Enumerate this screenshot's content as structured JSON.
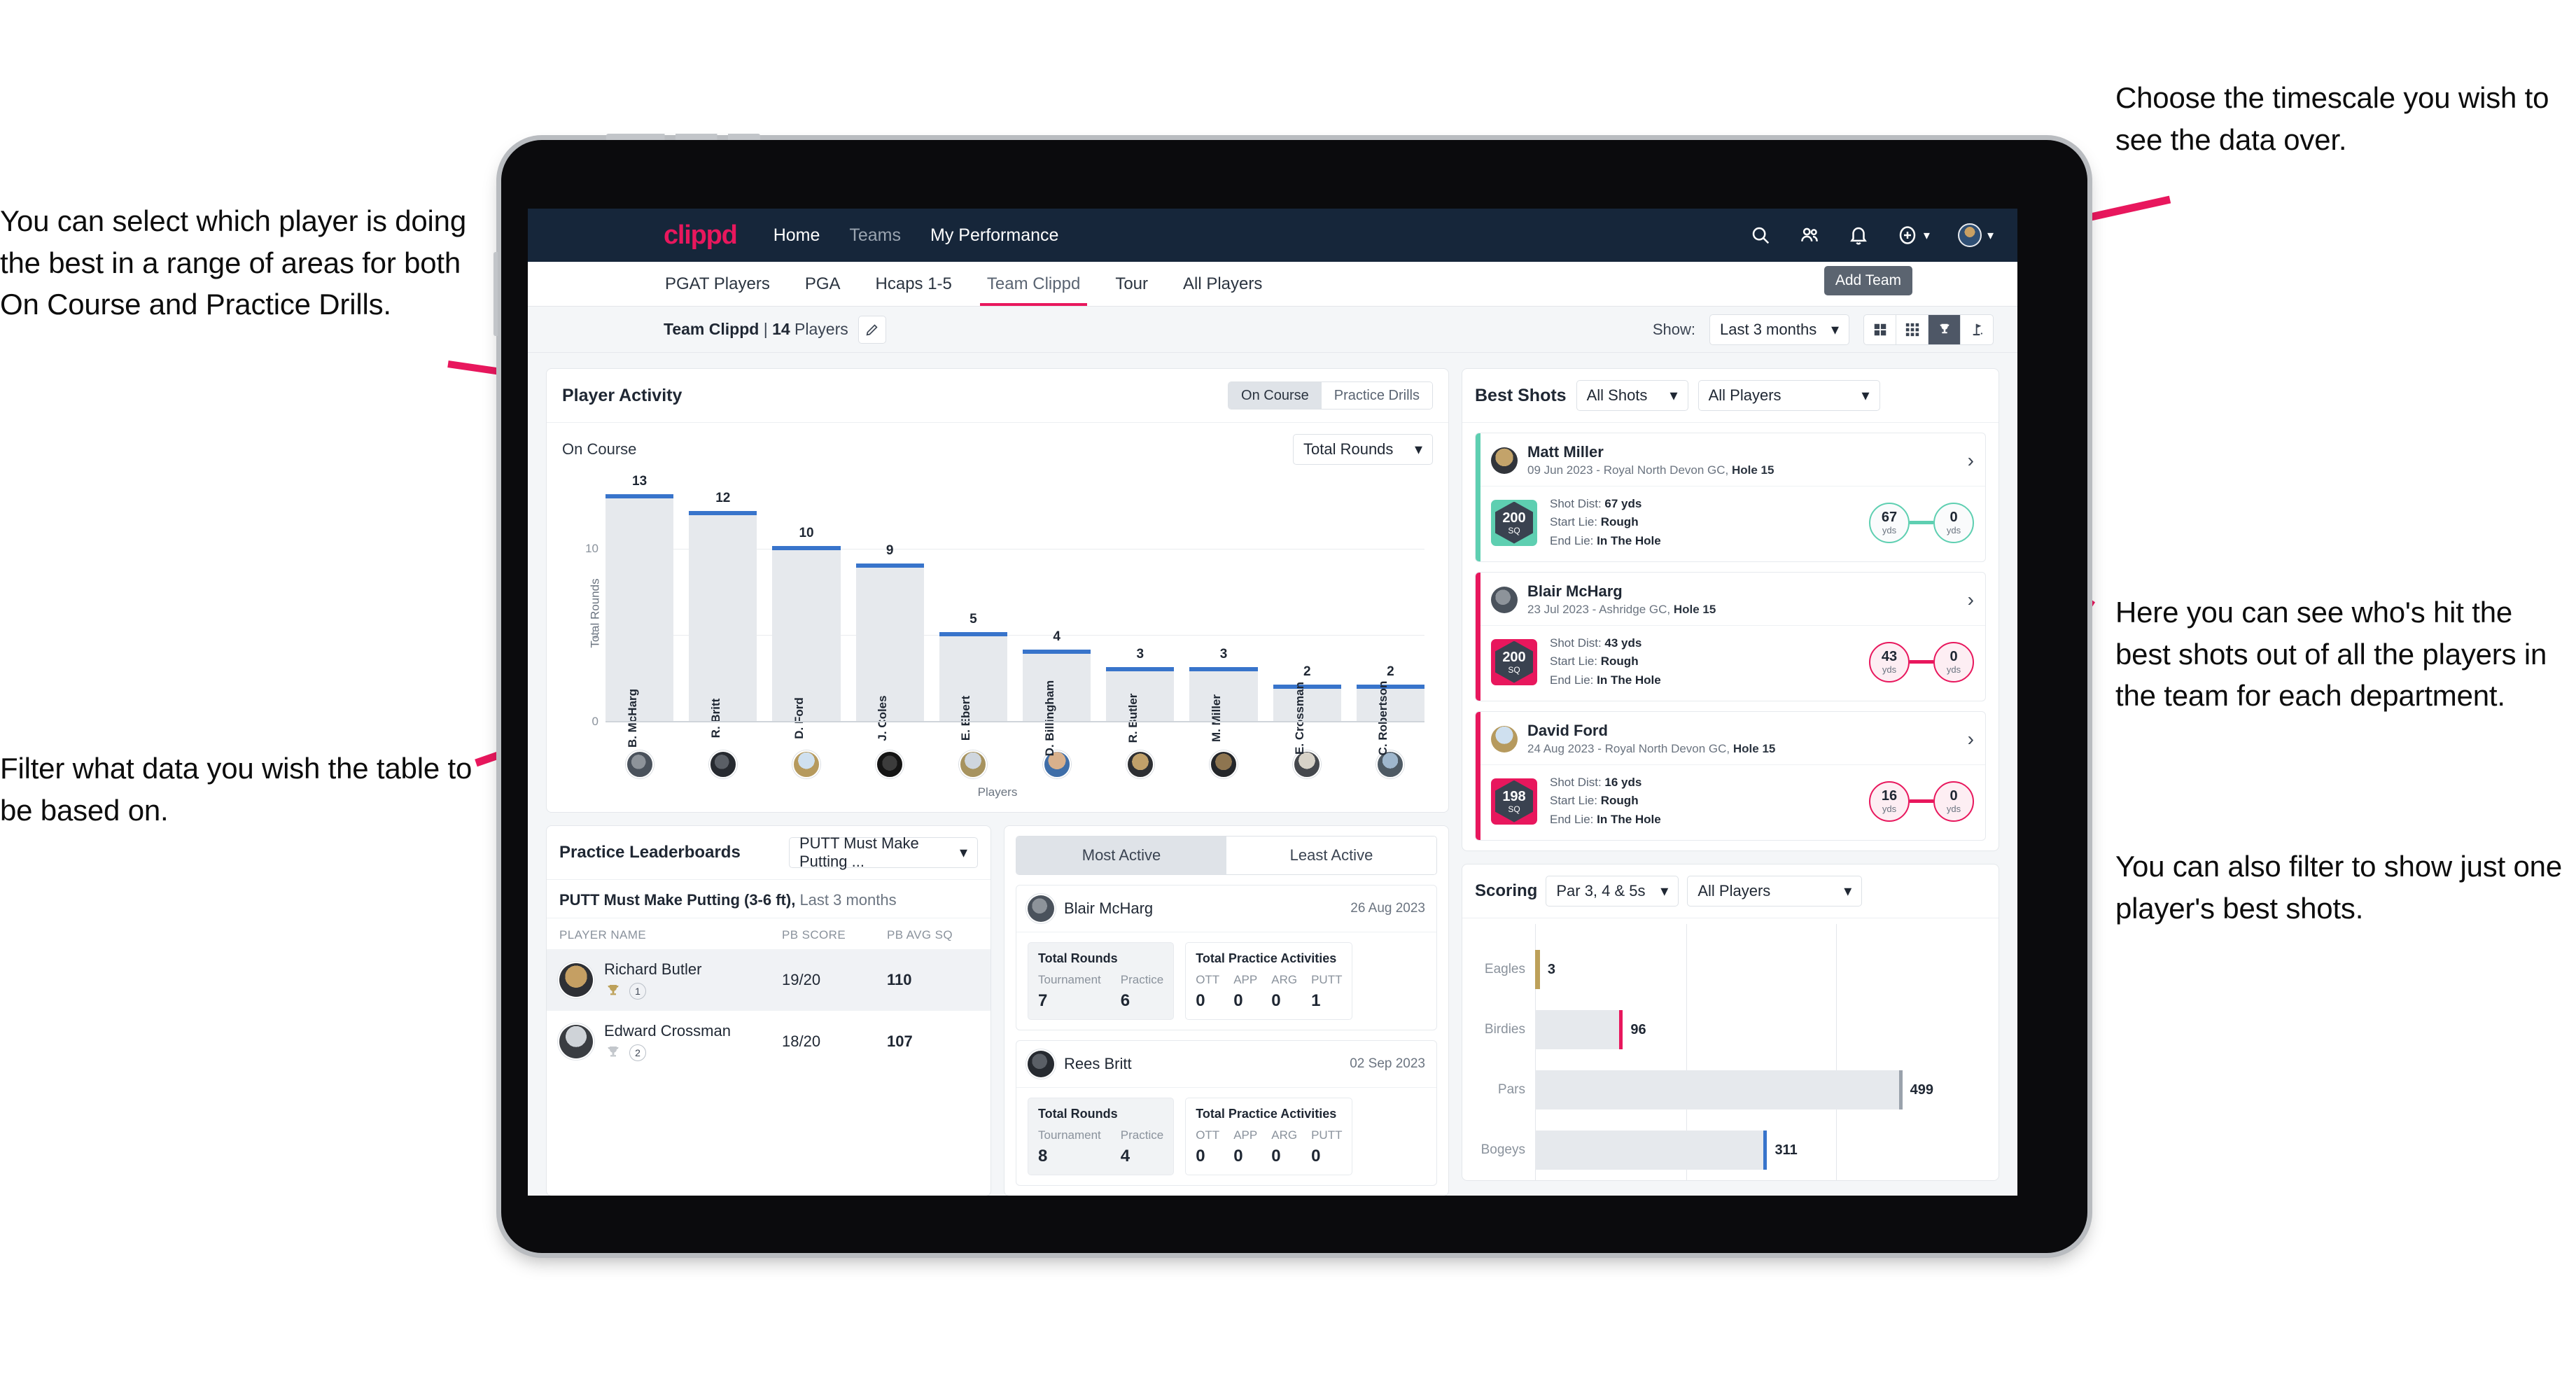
{
  "annotations": {
    "left_top": "You can select which player is doing the best in a range of areas for both On Course and Practice Drills.",
    "left_bottom": "Filter what data you wish the table to be based on.",
    "right_top": "Choose the timescale you wish to see the data over.",
    "right_mid": "Here you can see who's hit the best shots out of all the players in the team for each department.",
    "right_bottom": "You can also filter to show just one player's best shots."
  },
  "colors": {
    "brand_pink": "#e8175d",
    "navbar": "#16263a",
    "bar_blue": "#3874cb",
    "teal": "#5ecfb1",
    "gold": "#bda15a"
  },
  "topbar": {
    "brand": "clippd",
    "nav": [
      {
        "label": "Home",
        "dim": false
      },
      {
        "label": "Teams",
        "dim": true
      },
      {
        "label": "My Performance",
        "dim": false
      }
    ],
    "icons": [
      "search-icon",
      "people-icon",
      "bell-icon",
      "plus-circle-icon",
      "avatar"
    ]
  },
  "tabs": [
    {
      "label": "PGAT Players",
      "active": false
    },
    {
      "label": "PGA",
      "active": false
    },
    {
      "label": "Hcaps 1-5",
      "active": false
    },
    {
      "label": "Team Clippd",
      "active": true
    },
    {
      "label": "Tour",
      "active": false
    },
    {
      "label": "All Players",
      "active": false
    }
  ],
  "tooltip": {
    "add_team": "Add Team"
  },
  "subbar": {
    "team_name": "Team Clippd",
    "separator": " | ",
    "player_count": "14",
    "players_word": " Players",
    "show_label": "Show:",
    "timescale_value": "Last 3 months",
    "view_toggle": [
      {
        "name": "grid-large-icon",
        "active": false
      },
      {
        "name": "grid-small-icon",
        "active": false
      },
      {
        "name": "trophy-icon",
        "active": true
      },
      {
        "name": "flag-icon",
        "active": false
      }
    ]
  },
  "player_activity": {
    "title": "Player Activity",
    "segments": [
      {
        "label": "On Course",
        "active": true
      },
      {
        "label": "Practice Drills",
        "active": false
      }
    ],
    "subtitle": "On Course",
    "metric_select": "Total Rounds"
  },
  "chart_data": [
    {
      "type": "bar",
      "title": "Player Activity - On Course",
      "xlabel": "Players",
      "ylabel": "Total Rounds",
      "ylim": [
        0,
        14
      ],
      "yticks": [
        5,
        10
      ],
      "grid": true,
      "categories": [
        "B. McHarg",
        "R. Britt",
        "D. Ford",
        "J. Coles",
        "E. Ebert",
        "D. Billingham",
        "R. Butler",
        "M. Miller",
        "E. Crossman",
        "C. Robertson"
      ],
      "values": [
        13,
        12,
        10,
        9,
        5,
        4,
        3,
        3,
        2,
        2
      ]
    },
    {
      "type": "bar",
      "orientation": "horizontal",
      "title": "Scoring",
      "xlabel": "",
      "ylabel": "",
      "categories": [
        "Eagles",
        "Birdies",
        "Pars",
        "Bogeys"
      ],
      "values": [
        3,
        96,
        499,
        311
      ],
      "xlim": [
        0,
        620
      ],
      "colors": [
        "#bda15a",
        "#e8175d",
        "#9aa2ac",
        "#3874cb"
      ]
    }
  ],
  "best_shots": {
    "title": "Best Shots",
    "shot_filter": "All Shots",
    "player_filter": "All Players",
    "cards": [
      {
        "name": "Matt Miller",
        "meta_date": "09 Jun 2023 - Royal North Devon GC, ",
        "meta_hole": "Hole 15",
        "badge_value": "200",
        "badge_unit": "SQ",
        "badge_color": "#5ecfb1",
        "edge_color": "#5ecfb1",
        "shot_dist_label": "Shot Dist: ",
        "shot_dist_value": "67 yds",
        "start_lie_label": "Start Lie: ",
        "start_lie_value": "Rough",
        "end_lie_label": "End Lie: ",
        "end_lie_value": "In The Hole",
        "start_num": "67",
        "start_unit": "yds",
        "end_num": "0",
        "end_unit": "yds"
      },
      {
        "name": "Blair McHarg",
        "meta_date": "23 Jul 2023 - Ashridge GC, ",
        "meta_hole": "Hole 15",
        "badge_value": "200",
        "badge_unit": "SQ",
        "badge_color": "#e8175d",
        "edge_color": "#e8175d",
        "shot_dist_label": "Shot Dist: ",
        "shot_dist_value": "43 yds",
        "start_lie_label": "Start Lie: ",
        "start_lie_value": "Rough",
        "end_lie_label": "End Lie: ",
        "end_lie_value": "In The Hole",
        "start_num": "43",
        "start_unit": "yds",
        "end_num": "0",
        "end_unit": "yds"
      },
      {
        "name": "David Ford",
        "meta_date": "24 Aug 2023 - Royal North Devon GC, ",
        "meta_hole": "Hole 15",
        "badge_value": "198",
        "badge_unit": "SQ",
        "badge_color": "#e8175d",
        "edge_color": "#e8175d",
        "shot_dist_label": "Shot Dist: ",
        "shot_dist_value": "16 yds",
        "start_lie_label": "Start Lie: ",
        "start_lie_value": "Rough",
        "end_lie_label": "End Lie: ",
        "end_lie_value": "In The Hole",
        "start_num": "16",
        "start_unit": "yds",
        "end_num": "0",
        "end_unit": "yds"
      }
    ]
  },
  "practice_leaderboards": {
    "title": "Practice Leaderboards",
    "drill_select": "PUTT Must Make Putting ...",
    "sub_title": "PUTT Must Make Putting (3-6 ft),",
    "sub_range": " Last 3 months",
    "columns": [
      "PLAYER NAME",
      "PB SCORE",
      "PB AVG SQ"
    ],
    "rows": [
      {
        "name": "Richard Butler",
        "rank": "1",
        "trophy": "gold",
        "pb_score": "19/20",
        "pb_avg_sq": "110",
        "highlight": true
      },
      {
        "name": "Edward Crossman",
        "rank": "2",
        "trophy": "silver",
        "pb_score": "18/20",
        "pb_avg_sq": "107",
        "highlight": false
      }
    ]
  },
  "activity": {
    "tabs": [
      {
        "label": "Most Active",
        "active": true
      },
      {
        "label": "Least Active",
        "active": false
      }
    ],
    "cards": [
      {
        "name": "Blair McHarg",
        "date": "26 Aug 2023",
        "rounds_title": "Total Rounds",
        "rounds": [
          {
            "key": "Tournament",
            "value": "7"
          },
          {
            "key": "Practice",
            "value": "6"
          }
        ],
        "practice_title": "Total Practice Activities",
        "practice": [
          {
            "key": "OTT",
            "value": "0"
          },
          {
            "key": "APP",
            "value": "0"
          },
          {
            "key": "ARG",
            "value": "0"
          },
          {
            "key": "PUTT",
            "value": "1"
          }
        ]
      },
      {
        "name": "Rees Britt",
        "date": "02 Sep 2023",
        "rounds_title": "Total Rounds",
        "rounds": [
          {
            "key": "Tournament",
            "value": "8"
          },
          {
            "key": "Practice",
            "value": "4"
          }
        ],
        "practice_title": "Total Practice Activities",
        "practice": [
          {
            "key": "OTT",
            "value": "0"
          },
          {
            "key": "APP",
            "value": "0"
          },
          {
            "key": "ARG",
            "value": "0"
          },
          {
            "key": "PUTT",
            "value": "0"
          }
        ]
      }
    ]
  },
  "scoring": {
    "title": "Scoring",
    "par_select": "Par 3, 4 & 5s",
    "player_select": "All Players",
    "rows": [
      {
        "label": "Eagles",
        "value": "3",
        "color": "#bda15a",
        "pct": 0.6
      },
      {
        "label": "Birdies",
        "value": "96",
        "color": "#e8175d",
        "pct": 19
      },
      {
        "label": "Pars",
        "value": "499",
        "color": "#9aa2ac",
        "pct": 98
      },
      {
        "label": "Bogeys",
        "value": "311",
        "color": "#3874cb",
        "pct": 62
      }
    ]
  }
}
